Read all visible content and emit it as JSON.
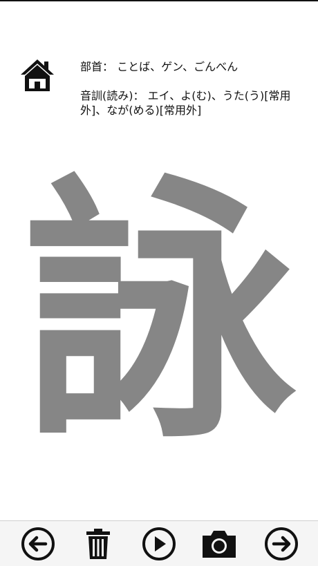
{
  "header": {
    "radical_line": "部首： ことば、ゲン、ごんべん",
    "reading_line": "音訓(読み)： エイ、よ(む)、うた(う)[常用外]、なが(める)[常用外]"
  },
  "kanji": {
    "character": "詠",
    "color": "#868686"
  },
  "icons": {
    "home": "home-icon",
    "back": "arrow-left-icon",
    "delete": "trash-icon",
    "play": "play-icon",
    "camera": "camera-icon",
    "next": "arrow-right-icon"
  },
  "colors": {
    "background": "#ffffff",
    "toolbar": "#f5f5f5",
    "icon": "#111111"
  }
}
